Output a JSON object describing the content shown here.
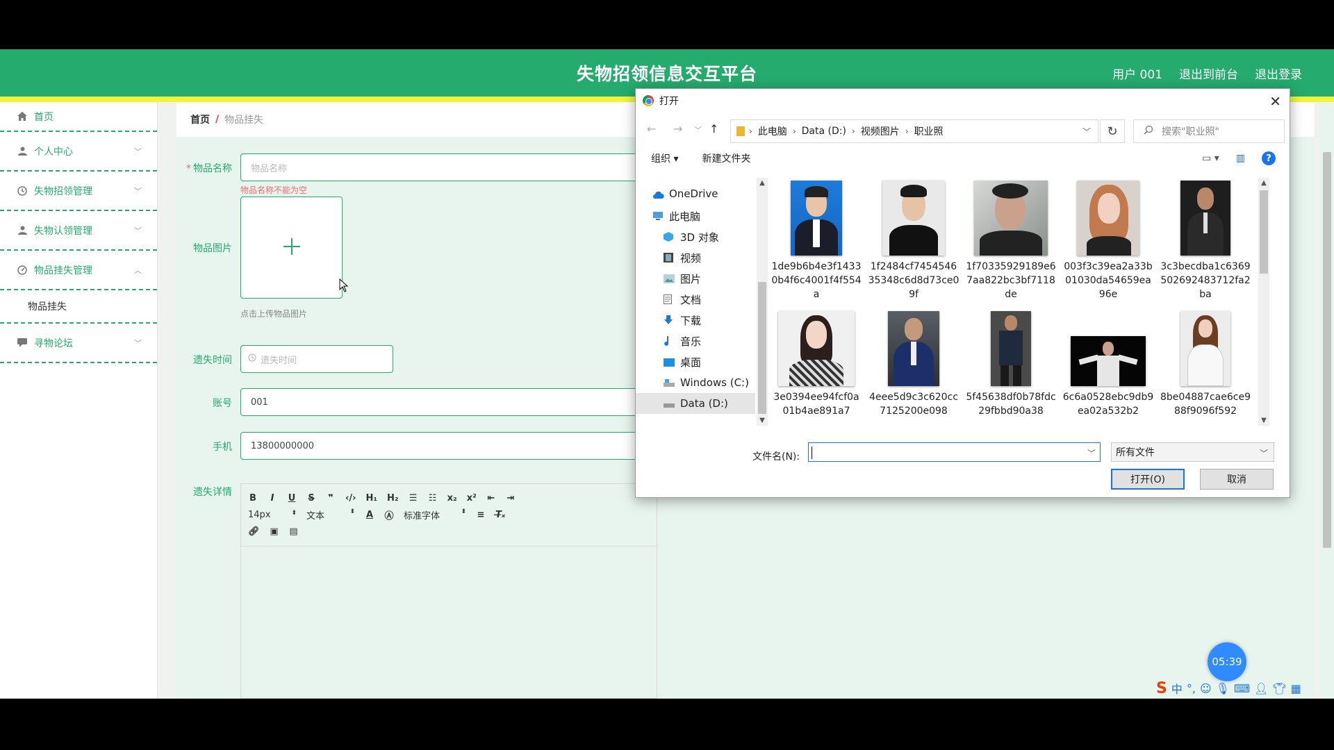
{
  "header": {
    "title": "失物招领信息交互平台",
    "user": "用户 001",
    "to_front": "退出到前台",
    "logout": "退出登录"
  },
  "sidebar": {
    "items": [
      {
        "label": "首页",
        "icon": "home-icon"
      },
      {
        "label": "个人中心",
        "icon": "user-icon"
      },
      {
        "label": "失物招领管理",
        "icon": "clock-icon"
      },
      {
        "label": "失物认领管理",
        "icon": "user-icon"
      },
      {
        "label": "物品挂失管理",
        "icon": "dashboard-icon"
      },
      {
        "label": "寻物论坛",
        "icon": "forum-icon"
      }
    ],
    "submenu_label": "物品挂失"
  },
  "breadcrumb": {
    "home": "首页",
    "separator": "/",
    "current": "物品挂失"
  },
  "form": {
    "name_label": "物品名称",
    "name_placeholder": "物品名称",
    "name_error": "物品名称不能为空",
    "image_label": "物品图片",
    "upload_hint": "点击上传物品图片",
    "time_label": "遗失时间",
    "time_placeholder": "遗失时间",
    "account_label": "账号",
    "account_value": "001",
    "phone_label": "手机",
    "phone_value": "13800000000",
    "detail_label": "遗失详情"
  },
  "editor": {
    "font_size": "14px",
    "text_type": "文本",
    "font_family": "标准字体"
  },
  "dialog": {
    "title": "打开",
    "path": [
      "此电脑",
      "Data (D:)",
      "视频图片",
      "职业照"
    ],
    "search_placeholder": "搜索\"职业照\"",
    "organize": "组织",
    "new_folder": "新建文件夹",
    "nav_items": [
      {
        "label": "OneDrive",
        "icon": "cloud-icon"
      },
      {
        "label": "此电脑",
        "icon": "computer-icon"
      },
      {
        "label": "3D 对象",
        "icon": "cube-icon"
      },
      {
        "label": "视频",
        "icon": "film-icon"
      },
      {
        "label": "图片",
        "icon": "picture-icon"
      },
      {
        "label": "文档",
        "icon": "document-icon"
      },
      {
        "label": "下载",
        "icon": "download-icon"
      },
      {
        "label": "音乐",
        "icon": "music-icon"
      },
      {
        "label": "桌面",
        "icon": "desktop-icon"
      },
      {
        "label": "Windows (C:)",
        "icon": "drive-icon"
      },
      {
        "label": "Data (D:)",
        "icon": "drive-icon"
      }
    ],
    "files": [
      {
        "name": "1de9b6b4e3f14330b4f6c4001f4f554a"
      },
      {
        "name": "1f2484cf745454635348c6d8d73ce09f"
      },
      {
        "name": "1f70335929189e67aa822bc3bf7118de"
      },
      {
        "name": "003f3c39ea2a33b01030da54659ea96e"
      },
      {
        "name": "3c3becdba1c6369502692483712fa2ba"
      },
      {
        "name": "3e0394ee94fcf0a01b4ae891a7"
      },
      {
        "name": "4eee5d9c3c620cc7125200e098"
      },
      {
        "name": "5f45638df0b78fdc29fbbd90a38"
      },
      {
        "name": "6c6a0528ebc9db9ea02a532b2"
      },
      {
        "name": "8be04887cae6ce988f9096f592"
      }
    ],
    "filename_label": "文件名(N):",
    "filetype": "所有文件",
    "open_button": "打开(O)",
    "cancel_button": "取消"
  },
  "timer": "05:39",
  "ime": {
    "lang": "中"
  }
}
